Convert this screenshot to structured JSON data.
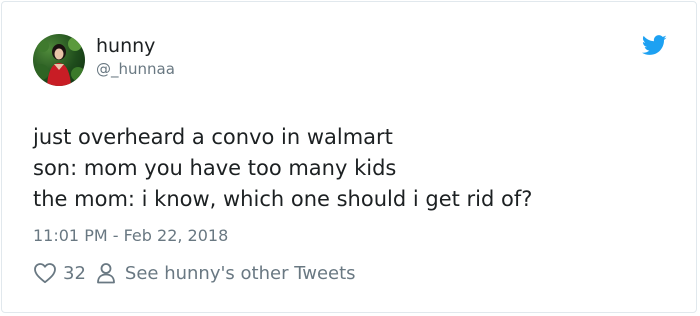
{
  "tweet": {
    "author": {
      "display_name": "hunny",
      "handle": "@_hunnaa"
    },
    "text_lines": [
      "just overheard a convo in walmart",
      "son: mom you have too many kids",
      "the mom: i know, which one should i get rid of?"
    ],
    "timestamp": "11:01 PM - Feb 22, 2018",
    "likes": "32",
    "other_tweets_label": "See hunny's other Tweets"
  },
  "icons": {
    "brand": "twitter-bird-icon",
    "like": "heart-icon",
    "profile": "person-icon"
  },
  "colors": {
    "twitter_blue": "#1da1f2",
    "text": "#1c2022",
    "muted": "#697882",
    "border": "#e1e8ed"
  }
}
